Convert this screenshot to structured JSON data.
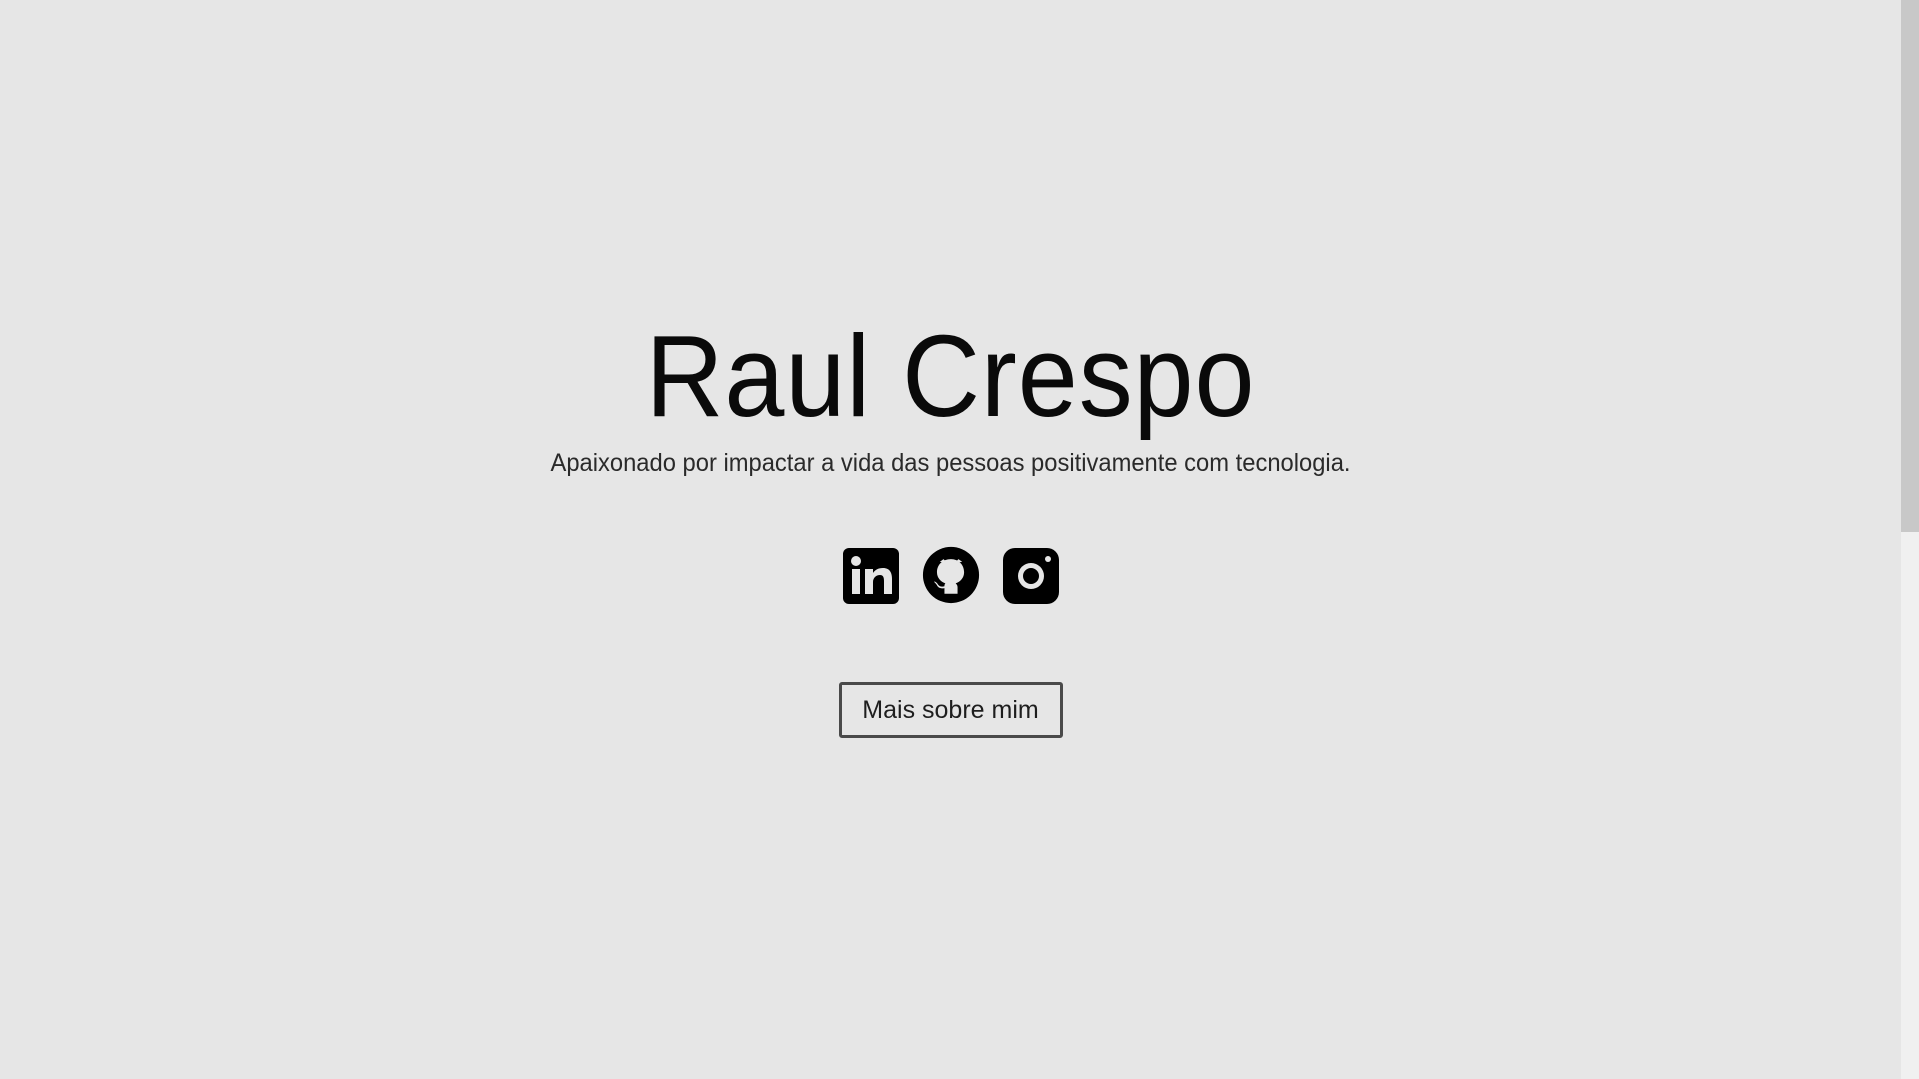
{
  "hero": {
    "name": "Raul Crespo",
    "tagline": "Apaixonado por impactar a vida das pessoas positivamente com tecnologia."
  },
  "social": {
    "links": [
      {
        "icon": "linkedin-icon"
      },
      {
        "icon": "github-icon"
      },
      {
        "icon": "instagram-icon"
      }
    ]
  },
  "cta": {
    "label": "Mais sobre mim"
  },
  "colors": {
    "background": "#e6e6e6",
    "text": "#0a0a0a",
    "button_border": "#4a4a4a"
  }
}
